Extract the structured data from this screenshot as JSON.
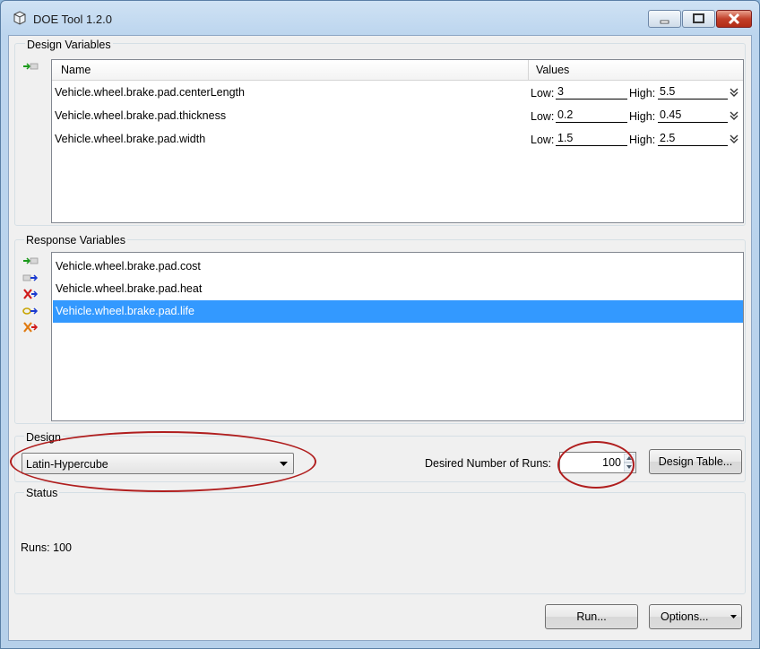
{
  "window": {
    "title": "DOE Tool 1.2.0"
  },
  "design_variables": {
    "group_label": "Design Variables",
    "columns": [
      "Name",
      "Values"
    ],
    "rows": [
      {
        "name": "Vehicle.wheel.brake.pad.centerLength",
        "low_label": "Low:",
        "low": "3",
        "high_label": "High:",
        "high": "5.5"
      },
      {
        "name": "Vehicle.wheel.brake.pad.thickness",
        "low_label": "Low:",
        "low": "0.2",
        "high_label": "High:",
        "high": "0.45"
      },
      {
        "name": "Vehicle.wheel.brake.pad.width",
        "low_label": "Low:",
        "low": "1.5",
        "high_label": "High:",
        "high": "2.5"
      }
    ]
  },
  "response_variables": {
    "group_label": "Response Variables",
    "items": [
      {
        "name": "Vehicle.wheel.brake.pad.cost",
        "selected": false
      },
      {
        "name": "Vehicle.wheel.brake.pad.heat",
        "selected": false
      },
      {
        "name": "Vehicle.wheel.brake.pad.life",
        "selected": true
      }
    ]
  },
  "design": {
    "group_label": "Design",
    "method": "Latin-Hypercube",
    "runs_label": "Desired Number of Runs:",
    "runs_value": "100",
    "design_table_button": "Design Table..."
  },
  "status": {
    "group_label": "Status",
    "text": "Runs: 100"
  },
  "footer": {
    "run_button": "Run...",
    "options_button": "Options..."
  },
  "colors": {
    "selection": "#3399ff",
    "annotation": "#b01e1e",
    "window_frame": "#bcd5ee"
  }
}
